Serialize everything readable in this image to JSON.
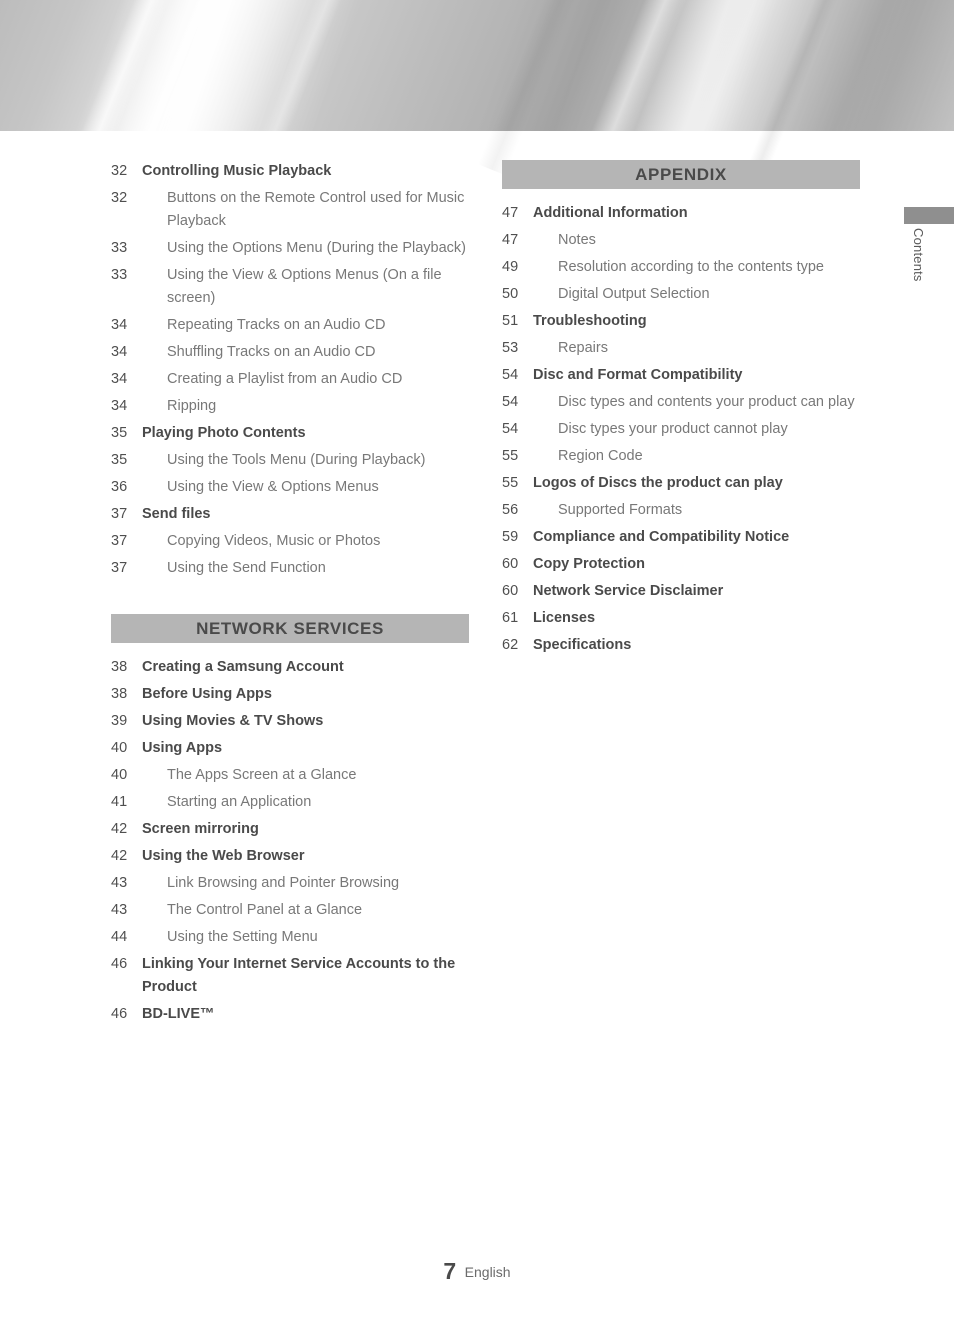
{
  "page": {
    "footer_page_number": "7",
    "footer_language": "English",
    "side_tab_label": "Contents"
  },
  "colors": {
    "section_bar_background": "#b5b5b5",
    "section_bar_text": "#4a4a4a",
    "level1_text": "#4a4a4a",
    "level2_text": "#787878",
    "page_number_text": "#4f4f4f",
    "side_tab_block": "#8f8f8f"
  },
  "left_column": {
    "entries_top": [
      {
        "page": "32",
        "title": "Controlling Music Playback",
        "level": 1
      },
      {
        "page": "32",
        "title": "Buttons on the Remote Control used for Music Playback",
        "level": 2
      },
      {
        "page": "33",
        "title": "Using the Options Menu (During the Playback)",
        "level": 2
      },
      {
        "page": "33",
        "title": "Using the View & Options Menus (On a file screen)",
        "level": 2
      },
      {
        "page": "34",
        "title": "Repeating Tracks on an Audio CD",
        "level": 2
      },
      {
        "page": "34",
        "title": "Shuffling Tracks on an Audio CD",
        "level": 2
      },
      {
        "page": "34",
        "title": "Creating a Playlist from an Audio CD",
        "level": 2
      },
      {
        "page": "34",
        "title": "Ripping",
        "level": 2
      },
      {
        "page": "35",
        "title": "Playing Photo Contents",
        "level": 1
      },
      {
        "page": "35",
        "title": "Using the Tools Menu (During Playback)",
        "level": 2
      },
      {
        "page": "36",
        "title": "Using the View & Options Menus",
        "level": 2
      },
      {
        "page": "37",
        "title": "Send files",
        "level": 1
      },
      {
        "page": "37",
        "title": "Copying Videos, Music or Photos",
        "level": 2
      },
      {
        "page": "37",
        "title": "Using the Send Function",
        "level": 2
      }
    ],
    "section": {
      "heading": "NETWORK SERVICES",
      "entries": [
        {
          "page": "38",
          "title": "Creating a Samsung Account",
          "level": 1
        },
        {
          "page": "38",
          "title": "Before Using Apps",
          "level": 1
        },
        {
          "page": "39",
          "title": "Using Movies & TV Shows",
          "level": 1
        },
        {
          "page": "40",
          "title": "Using Apps",
          "level": 1
        },
        {
          "page": "40",
          "title": "The Apps Screen at a Glance",
          "level": 2
        },
        {
          "page": "41",
          "title": "Starting an Application",
          "level": 2
        },
        {
          "page": "42",
          "title": "Screen mirroring",
          "level": 1
        },
        {
          "page": "42",
          "title": "Using the Web Browser",
          "level": 1
        },
        {
          "page": "43",
          "title": "Link Browsing and Pointer Browsing",
          "level": 2
        },
        {
          "page": "43",
          "title": "The Control Panel at a Glance",
          "level": 2
        },
        {
          "page": "44",
          "title": "Using the Setting Menu",
          "level": 2
        },
        {
          "page": "46",
          "title": "Linking Your Internet Service Accounts to the Product",
          "level": 1
        },
        {
          "page": "46",
          "title": "BD-LIVE™",
          "level": 1
        }
      ]
    }
  },
  "right_column": {
    "section": {
      "heading": "APPENDIX",
      "entries": [
        {
          "page": "47",
          "title": "Additional Information",
          "level": 1
        },
        {
          "page": "47",
          "title": "Notes",
          "level": 2
        },
        {
          "page": "49",
          "title": "Resolution according to the contents type",
          "level": 2
        },
        {
          "page": "50",
          "title": "Digital Output Selection",
          "level": 2
        },
        {
          "page": "51",
          "title": "Troubleshooting",
          "level": 1
        },
        {
          "page": "53",
          "title": "Repairs",
          "level": 2
        },
        {
          "page": "54",
          "title": "Disc and Format Compatibility",
          "level": 1
        },
        {
          "page": "54",
          "title": "Disc types and contents your product can play",
          "level": 2
        },
        {
          "page": "54",
          "title": "Disc types your product cannot play",
          "level": 2
        },
        {
          "page": "55",
          "title": "Region Code",
          "level": 2
        },
        {
          "page": "55",
          "title": "Logos of Discs the product can play",
          "level": 1
        },
        {
          "page": "56",
          "title": "Supported Formats",
          "level": 2
        },
        {
          "page": "59",
          "title": "Compliance and Compatibility Notice",
          "level": 1
        },
        {
          "page": "60",
          "title": "Copy Protection",
          "level": 1
        },
        {
          "page": "60",
          "title": "Network Service Disclaimer",
          "level": 1
        },
        {
          "page": "61",
          "title": "Licenses",
          "level": 1
        },
        {
          "page": "62",
          "title": "Specifications",
          "level": 1
        }
      ]
    }
  }
}
